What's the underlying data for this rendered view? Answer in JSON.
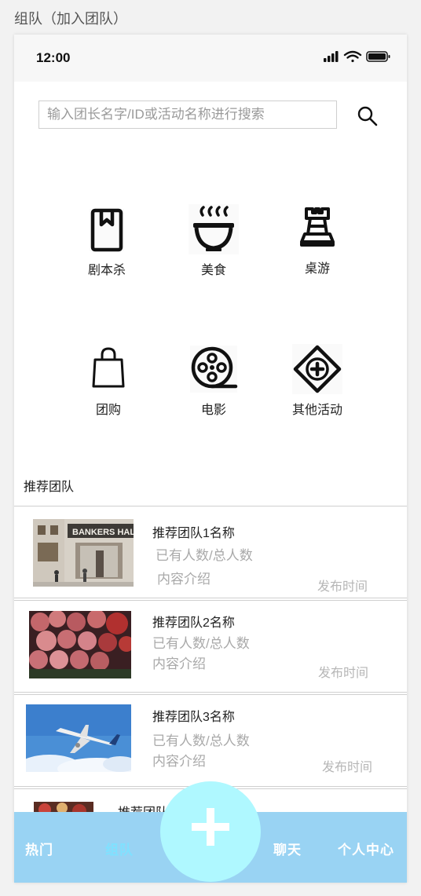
{
  "page_caption": "组队（加入团队）",
  "status_bar": {
    "time": "12:00"
  },
  "search": {
    "placeholder": "输入团长名字/ID或活动名称进行搜索",
    "value": ""
  },
  "categories": [
    {
      "label": "剧本杀",
      "icon": "script-book-icon"
    },
    {
      "label": "美食",
      "icon": "food-bowl-icon"
    },
    {
      "label": "桌游",
      "icon": "chess-rook-icon"
    },
    {
      "label": "团购",
      "icon": "shopping-bag-icon"
    },
    {
      "label": "电影",
      "icon": "film-reel-icon"
    },
    {
      "label": "其他活动",
      "icon": "diamond-plus-icon"
    }
  ],
  "recommended": {
    "title": "推荐团队",
    "teams": [
      {
        "name": "推荐团队1名称",
        "count": "已有人数/总人数",
        "desc": "内容介绍",
        "time": "发布时间",
        "image": "bank-building-photo",
        "image_text": "BANKERS HAL"
      },
      {
        "name": "推荐团队2名称",
        "count": "已有人数/总人数",
        "desc": "内容介绍",
        "time": "发布时间",
        "image": "roses-photo"
      },
      {
        "name": "推荐团队3名称",
        "count": "已有人数/总人数",
        "desc": "内容介绍",
        "time": "发布时间",
        "image": "airplane-photo"
      },
      {
        "name": "推荐团队",
        "image": "food-photo"
      }
    ]
  },
  "tab_bar": {
    "tabs": [
      {
        "label": "热门",
        "active": false
      },
      {
        "label": "组队",
        "active": true
      },
      {
        "label": "聊天",
        "active": false
      },
      {
        "label": "个人中心",
        "active": false
      }
    ],
    "fab_icon": "plus-icon"
  },
  "colors": {
    "tab_bar_bg": "#99d3f3",
    "tab_active": "#7fe1ff",
    "fab_bg": "#aff8ff",
    "muted_text": "#a9a9a9"
  }
}
